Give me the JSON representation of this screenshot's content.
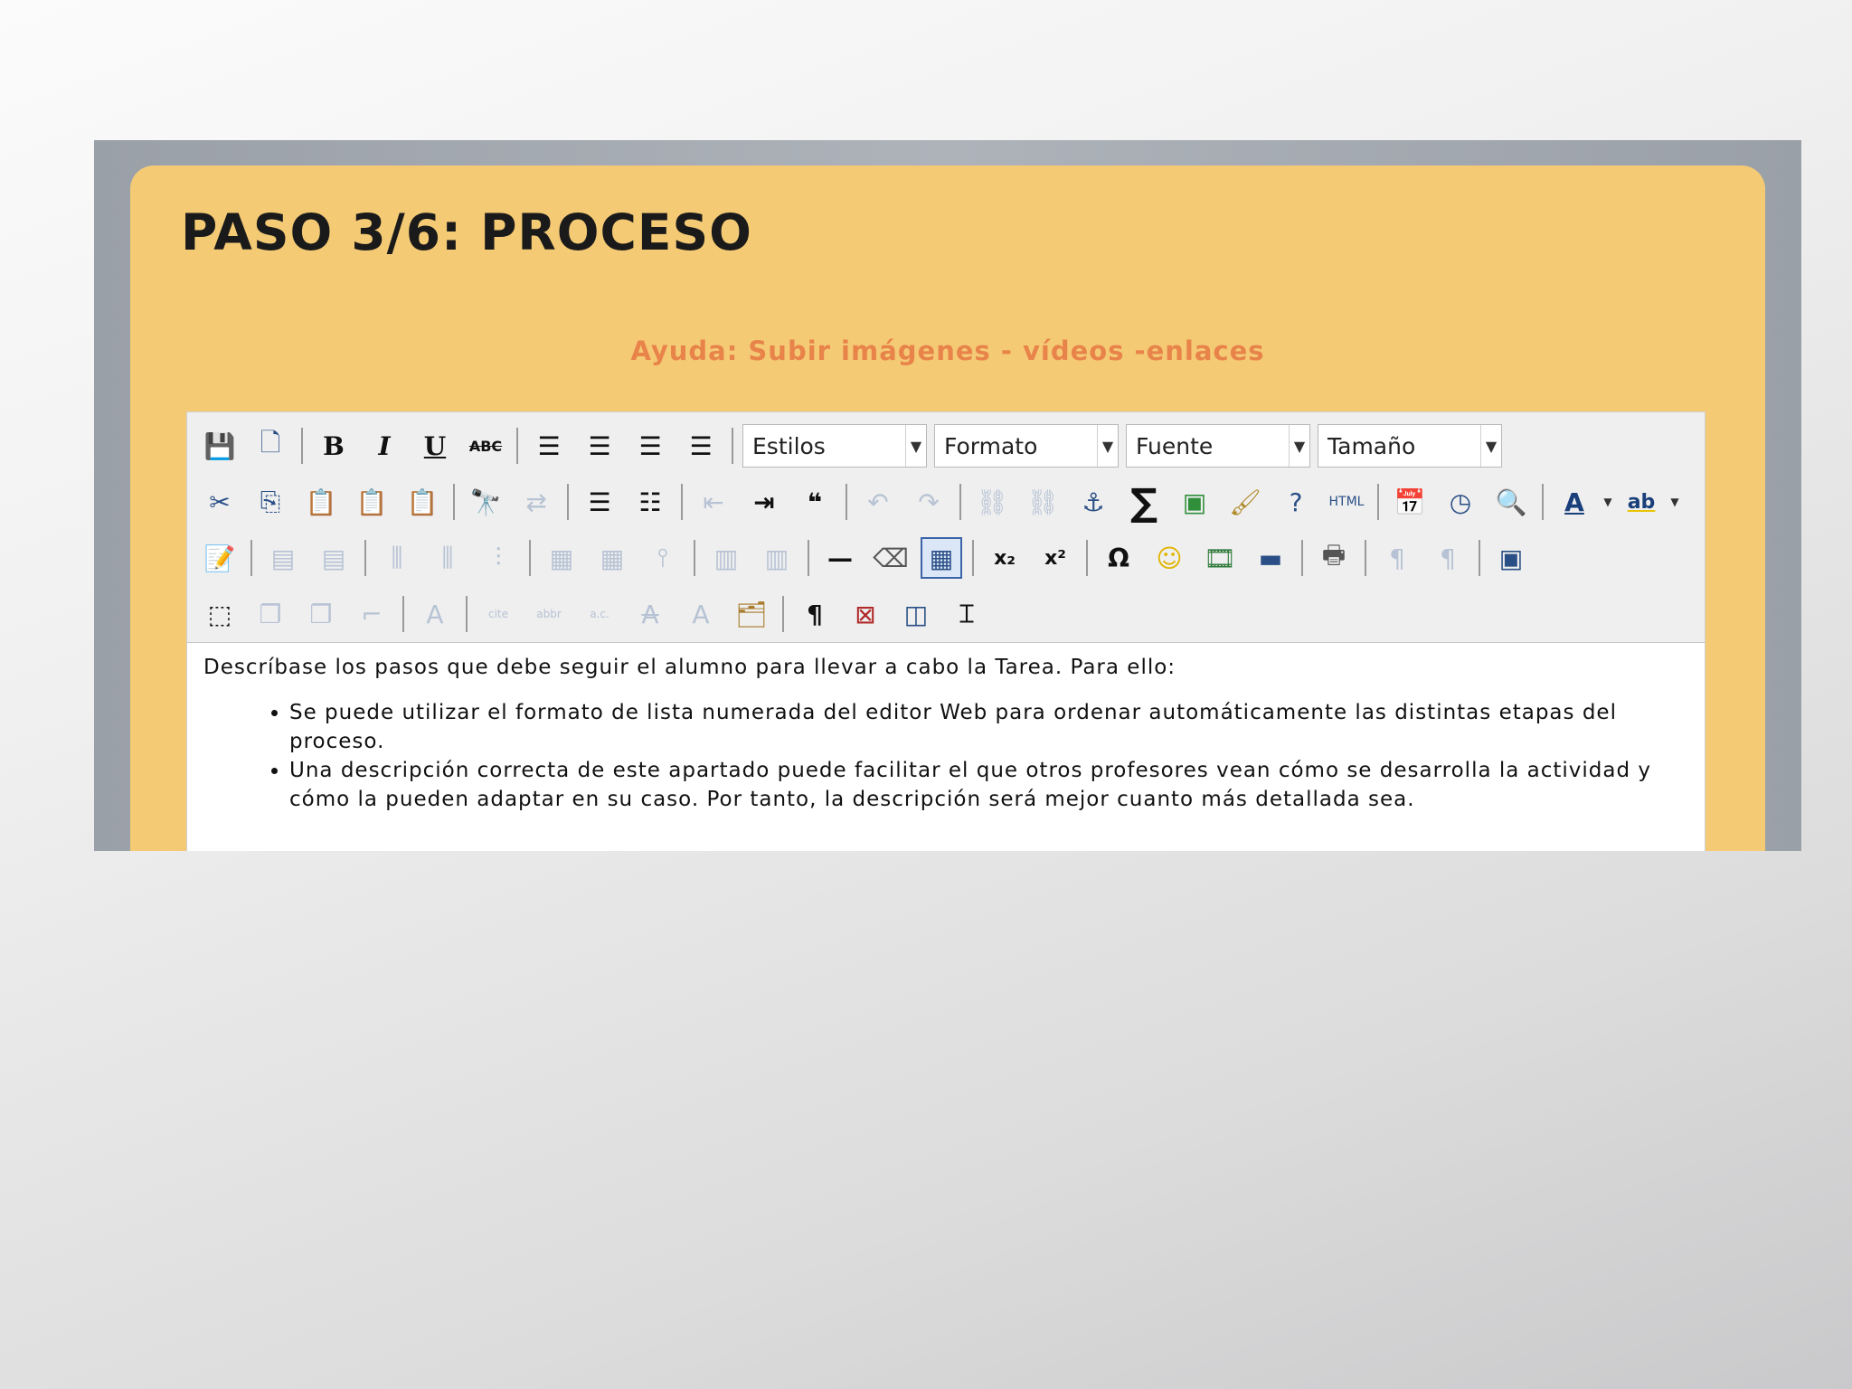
{
  "step_title": "PASO 3/6: PROCESO",
  "help_link": "Ayuda: Subir imágenes - vídeos -enlaces",
  "toolbar": {
    "styles_combo": "Estilos",
    "format_combo": "Formato",
    "font_combo": "Fuente",
    "size_combo": "Tamaño",
    "html_label": "HTML"
  },
  "editor": {
    "intro": "Descríbase los pasos que debe seguir el alumno para llevar a cabo la Tarea. Para ello:",
    "bullets": [
      "Se puede utilizar el formato de lista numerada del editor Web para ordenar automáticamente las distintas etapas del proceso.",
      "Una descripción correcta de este apartado puede facilitar el que otros profesores vean cómo se desarrolla la actividad y cómo la pueden adaptar en su caso. Por tanto, la descripción será mejor cuanto más detallada sea."
    ]
  },
  "colors": {
    "panel": "#f4ca75",
    "help_link": "#e8834a",
    "frame": "#a3a8af"
  }
}
